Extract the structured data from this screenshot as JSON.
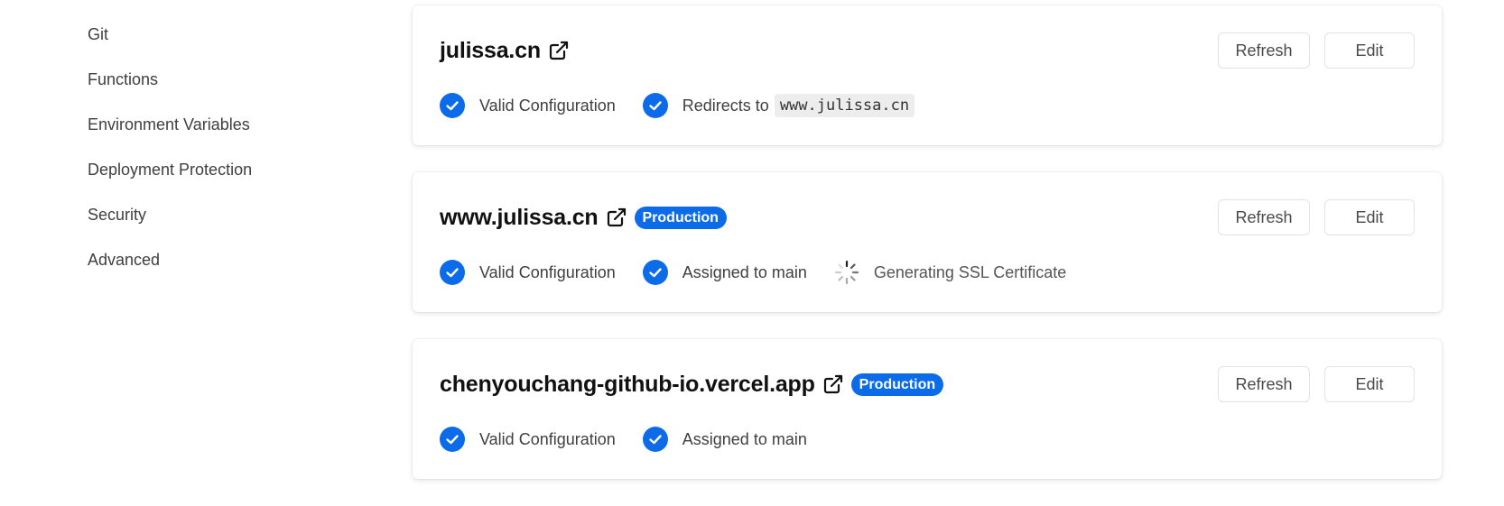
{
  "sidebar": {
    "items": [
      {
        "label": "Git"
      },
      {
        "label": "Functions"
      },
      {
        "label": "Environment Variables"
      },
      {
        "label": "Deployment Protection"
      },
      {
        "label": "Security"
      },
      {
        "label": "Advanced"
      }
    ]
  },
  "colors": {
    "accent": "#0b6be8",
    "check": "#0b6be8"
  },
  "cards": [
    {
      "domain": "julissa.cn",
      "refresh_label": "Refresh",
      "edit_label": "Edit",
      "statuses": [
        {
          "label": "Valid Configuration",
          "icon": "check-circle-icon"
        },
        {
          "label": "Redirects to",
          "code": "www.julissa.cn",
          "icon": "check-circle-icon"
        }
      ]
    },
    {
      "domain": "www.julissa.cn",
      "badge": "Production",
      "refresh_label": "Refresh",
      "edit_label": "Edit",
      "statuses": [
        {
          "label": "Valid Configuration",
          "icon": "check-circle-icon"
        },
        {
          "label": "Assigned to main",
          "icon": "check-circle-icon"
        },
        {
          "label": "Generating SSL Certificate",
          "icon": "spinner-icon"
        }
      ]
    },
    {
      "domain": "chenyouchang-github-io.vercel.app",
      "badge": "Production",
      "refresh_label": "Refresh",
      "edit_label": "Edit",
      "statuses": [
        {
          "label": "Valid Configuration",
          "icon": "check-circle-icon"
        },
        {
          "label": "Assigned to main",
          "icon": "check-circle-icon"
        }
      ]
    }
  ]
}
